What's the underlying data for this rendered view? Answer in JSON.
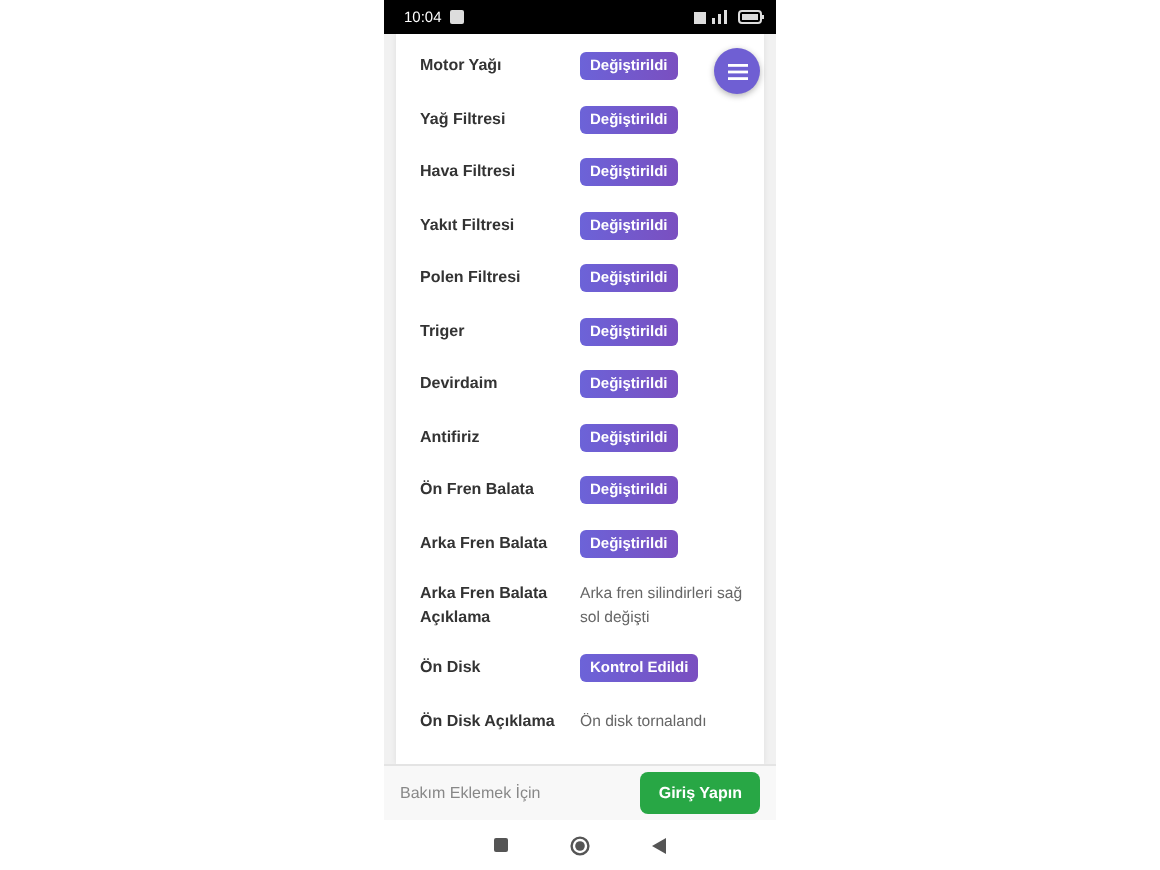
{
  "status_bar": {
    "time": "10:04"
  },
  "items": [
    {
      "label": "Motor Yağı",
      "kind": "badge",
      "value": "Değiştirildi"
    },
    {
      "label": "Yağ Filtresi",
      "kind": "badge",
      "value": "Değiştirildi"
    },
    {
      "label": "Hava Filtresi",
      "kind": "badge",
      "value": "Değiştirildi"
    },
    {
      "label": "Yakıt Filtresi",
      "kind": "badge",
      "value": "Değiştirildi"
    },
    {
      "label": "Polen Filtresi",
      "kind": "badge",
      "value": "Değiştirildi"
    },
    {
      "label": "Triger",
      "kind": "badge",
      "value": "Değiştirildi"
    },
    {
      "label": "Devirdaim",
      "kind": "badge",
      "value": "Değiştirildi"
    },
    {
      "label": "Antifiriz",
      "kind": "badge",
      "value": "Değiştirildi"
    },
    {
      "label": "Ön Fren Balata",
      "kind": "badge",
      "value": "Değiştirildi"
    },
    {
      "label": "Arka Fren Balata",
      "kind": "badge",
      "value": "Değiştirildi"
    },
    {
      "label": "Arka Fren Balata Açıklama",
      "kind": "text",
      "value": "Arka fren silindirleri sağ sol değişti"
    },
    {
      "label": "Ön Disk",
      "kind": "badge",
      "value": "Kontrol Edildi"
    },
    {
      "label": "Ön Disk Açıklama",
      "kind": "text",
      "value": "Ön disk tornalandı"
    }
  ],
  "bottom_bar": {
    "text": "Bakım Eklemek İçin",
    "button": "Giriş Yapın"
  }
}
